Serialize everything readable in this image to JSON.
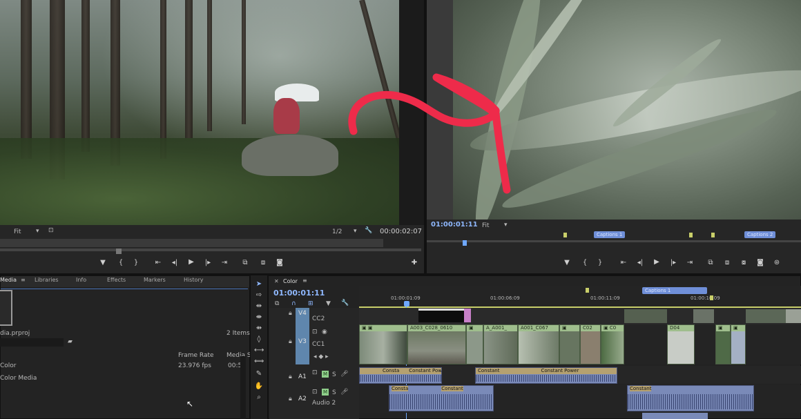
{
  "source_monitor": {
    "zoom_label": "Fit",
    "resolution": "1/2",
    "timecode": "00:00:02:07"
  },
  "program_monitor": {
    "timecode": "01:00:01:11",
    "zoom_label": "Fit",
    "captions": [
      "Captions 1",
      "Captions 2"
    ]
  },
  "project_panel": {
    "tabs": [
      "Media",
      "Libraries",
      "Info",
      "Effects",
      "Markers",
      "History"
    ],
    "project_name": "dia.prproj",
    "item_count": "2 Items",
    "columns": [
      "Frame Rate",
      "Media S"
    ],
    "rows": [
      {
        "name": "Color",
        "frame_rate": "23.976 fps",
        "media": "00:5"
      },
      {
        "name": "Color Media",
        "frame_rate": "",
        "media": ""
      }
    ]
  },
  "timeline": {
    "sequence_tab": "Color",
    "timecode": "01:00:01:11",
    "ruler": [
      "01:00:01:09",
      "01:00:06:09",
      "01:00:11:09",
      "01:00:16:09"
    ],
    "caption_clip": "Captions 1",
    "tracks": {
      "v4": "V4",
      "v4_name": "CC2",
      "v3": "V3",
      "v3_name": "CC1",
      "a1": "A1",
      "a2": "A2",
      "a2_name": "Audio 2",
      "m": "M",
      "s": "S"
    },
    "video_clips": [
      "A003_C028_0610",
      "A_A001_",
      "A001_C067",
      "C02",
      "D04"
    ],
    "audio_labels": {
      "consta": "Consta",
      "constant_power": "Constant Power",
      "constant": "Constant"
    }
  },
  "colors": {
    "accent_timecode": "#8fb8ff",
    "playhead": "#6fa8ff",
    "annotation_red": "#ee2b4a",
    "video_clip": "#9fbe8d",
    "audio_clip": "#7a8ab8"
  }
}
